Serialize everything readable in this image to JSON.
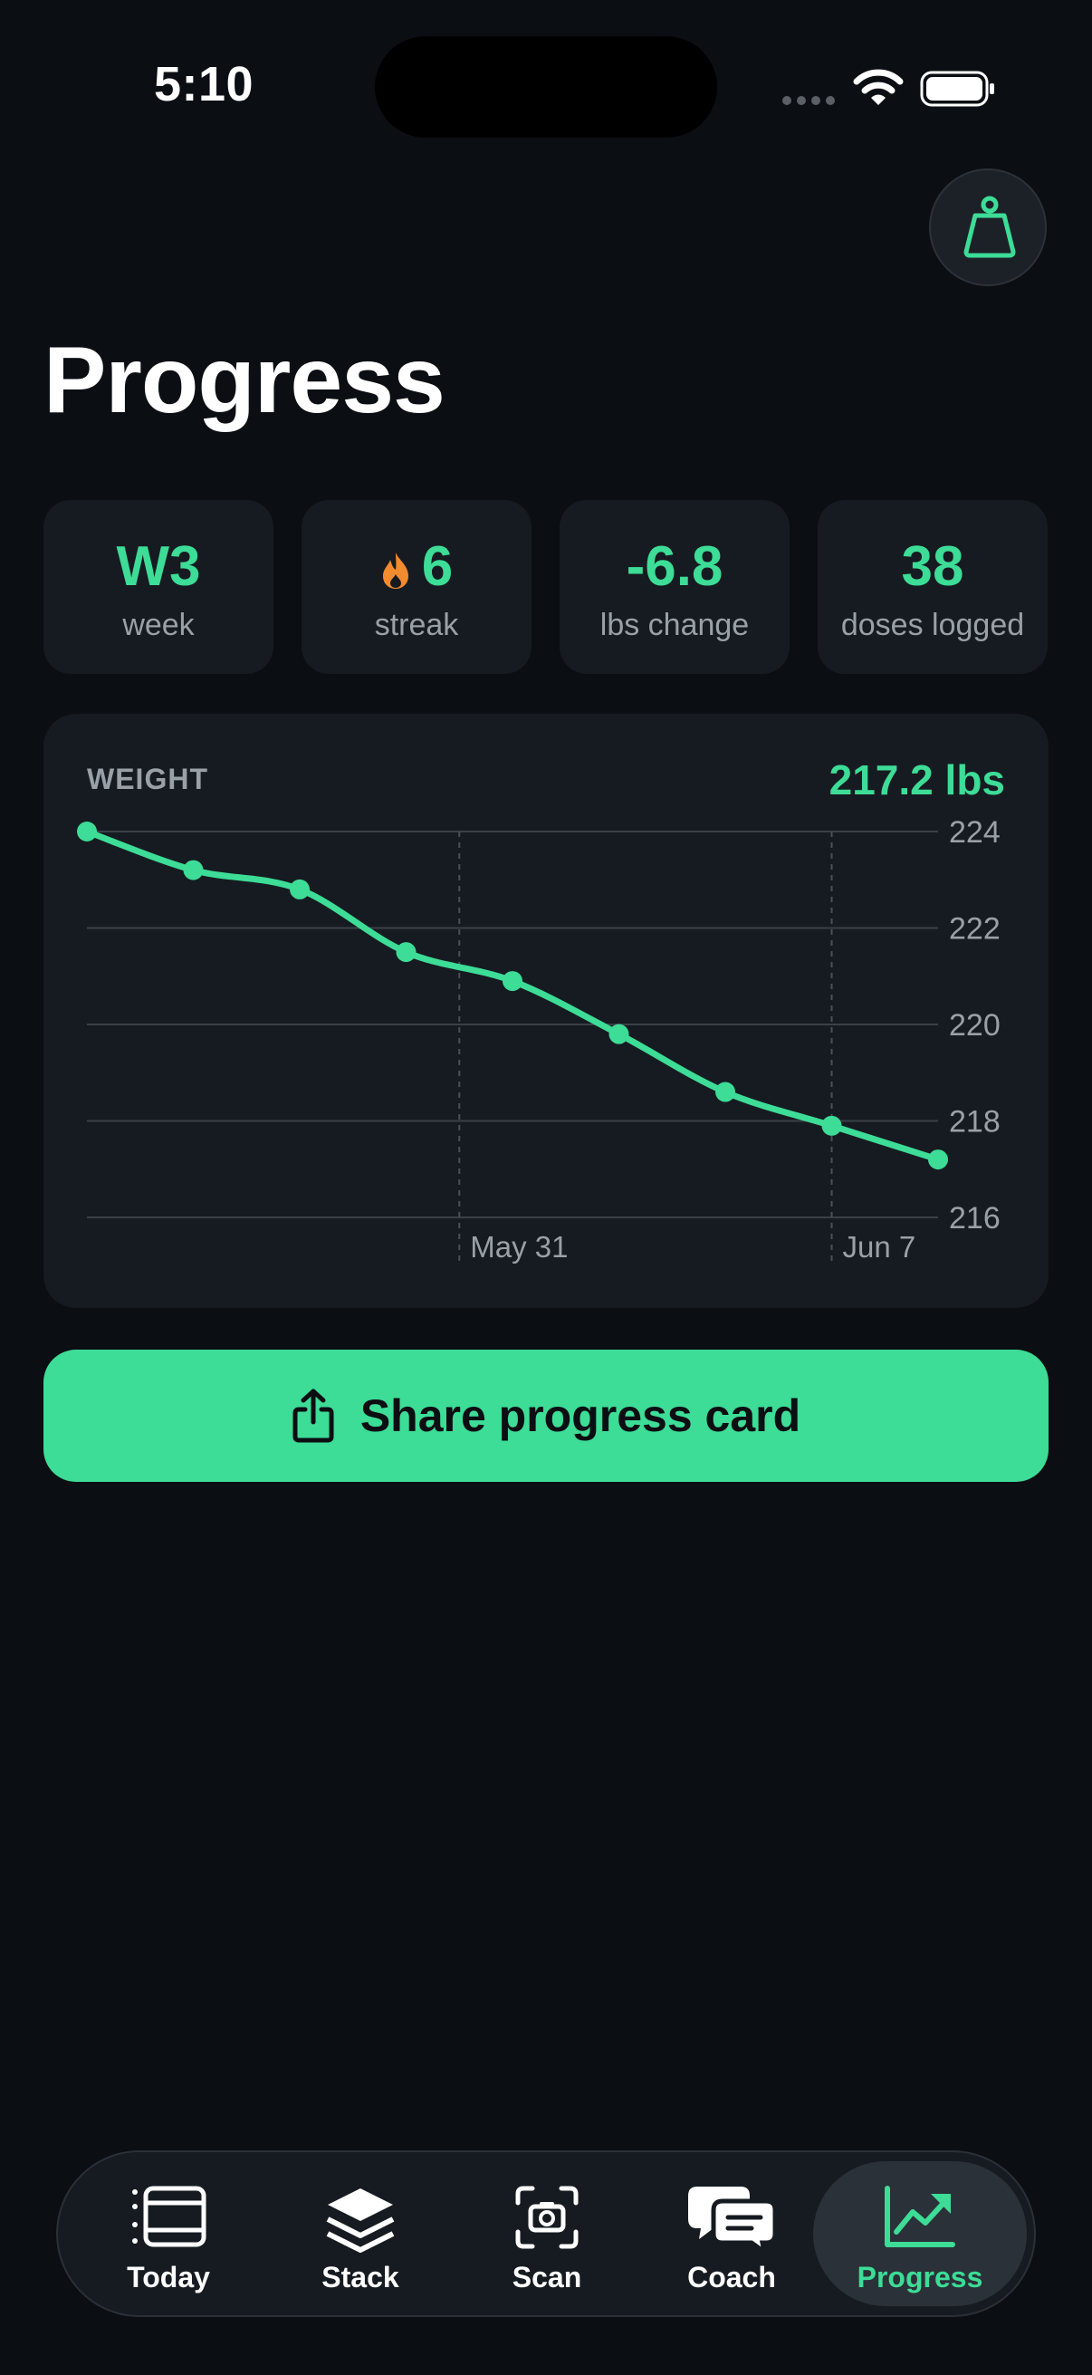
{
  "status_bar": {
    "time": "5:10"
  },
  "page": {
    "title": "Progress"
  },
  "stats": [
    {
      "value": "W3",
      "label": "week",
      "icon": null
    },
    {
      "value": "6",
      "label": "streak",
      "icon": "flame-icon"
    },
    {
      "value": "-6.8",
      "label": "lbs change",
      "icon": null
    },
    {
      "value": "38",
      "label": "doses logged",
      "icon": null
    }
  ],
  "weight_chart": {
    "label": "WEIGHT",
    "current": "217.2 lbs"
  },
  "chart_data": {
    "type": "line",
    "title": "WEIGHT",
    "values": [
      224.0,
      223.2,
      222.8,
      221.5,
      220.9,
      219.8,
      218.6,
      217.9,
      217.2
    ],
    "ylim": [
      216,
      224
    ],
    "y_ticks": [
      "224",
      "222",
      "220",
      "218",
      "216"
    ],
    "x_markers": [
      {
        "label": "May 31",
        "index": 3.5
      },
      {
        "label": "Jun 7",
        "index": 7
      }
    ],
    "grid": true,
    "color": "#3ddc97"
  },
  "actions": {
    "share_label": "Share progress card"
  },
  "tab_bar": {
    "items": [
      {
        "label": "Today",
        "icon": "today-icon"
      },
      {
        "label": "Stack",
        "icon": "stack-icon"
      },
      {
        "label": "Scan",
        "icon": "scan-icon"
      },
      {
        "label": "Coach",
        "icon": "coach-icon"
      },
      {
        "label": "Progress",
        "icon": "progress-chart-icon"
      }
    ],
    "active": "Progress"
  },
  "colors": {
    "accent": "#3ddc97",
    "background": "#0b0e12",
    "card": "#161b21",
    "flame": "#f28a2e"
  }
}
